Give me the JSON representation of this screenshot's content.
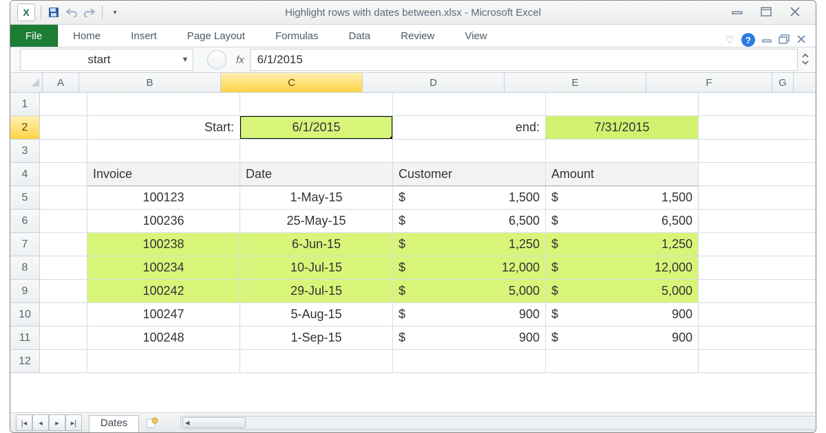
{
  "title": "Highlight rows with dates between.xlsx  -  Microsoft Excel",
  "ribbon": {
    "file": "File",
    "tabs": [
      "Home",
      "Insert",
      "Page Layout",
      "Formulas",
      "Data",
      "Review",
      "View"
    ]
  },
  "namebox": "start",
  "fx_label": "fx",
  "formula": "6/1/2015",
  "columns": [
    "A",
    "B",
    "C",
    "D",
    "E",
    "F",
    "G"
  ],
  "selected_col": "C",
  "selected_row": 2,
  "labels": {
    "start": "Start:",
    "end": "end:"
  },
  "dates": {
    "start": "6/1/2015",
    "end": "7/31/2015"
  },
  "headers": {
    "invoice": "Invoice",
    "date": "Date",
    "customer": "Customer",
    "amount": "Amount"
  },
  "rows": [
    {
      "inv": "100123",
      "date": "1-May-15",
      "cust": "1,500",
      "amt": "1,500",
      "hl": false
    },
    {
      "inv": "100236",
      "date": "25-May-15",
      "cust": "6,500",
      "amt": "6,500",
      "hl": false
    },
    {
      "inv": "100238",
      "date": "6-Jun-15",
      "cust": "1,250",
      "amt": "1,250",
      "hl": true
    },
    {
      "inv": "100234",
      "date": "10-Jul-15",
      "cust": "12,000",
      "amt": "12,000",
      "hl": true
    },
    {
      "inv": "100242",
      "date": "29-Jul-15",
      "cust": "5,000",
      "amt": "5,000",
      "hl": true
    },
    {
      "inv": "100247",
      "date": "5-Aug-15",
      "cust": "900",
      "amt": "900",
      "hl": false
    },
    {
      "inv": "100248",
      "date": "1-Sep-15",
      "cust": "900",
      "amt": "900",
      "hl": false
    }
  ],
  "currency": "$",
  "sheet_tab": "Dates",
  "chart_data": null
}
